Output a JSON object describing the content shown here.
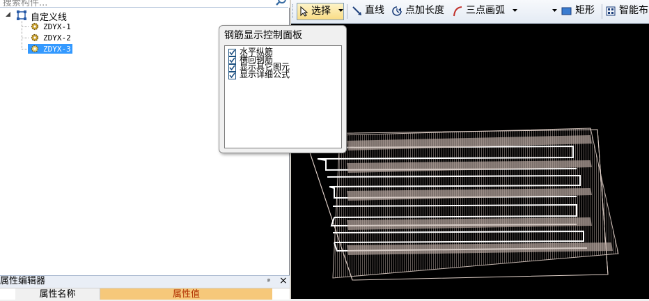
{
  "search": {
    "placeholder": "搜索构件..."
  },
  "tree": {
    "root_label": "自定义线",
    "items": [
      {
        "label": "ZDYX-1",
        "selected": false
      },
      {
        "label": "ZDYX-2",
        "selected": false
      },
      {
        "label": "ZDYX-3",
        "selected": true
      }
    ]
  },
  "property_editor": {
    "title": "属性编辑器",
    "pin_glyph": "ᵖ",
    "close_glyph": "×",
    "column_name": "属性名称",
    "column_value": "属性值"
  },
  "toolbar": {
    "select_label": "选择",
    "line_label": "直线",
    "point_length_label": "点加长度",
    "arc_label": "三点画弧",
    "rect_label": "矩形",
    "smart_label": "智能布"
  },
  "rebar_panel": {
    "title": "钢筋显示控制面板",
    "options": [
      {
        "label": "水平纵筋",
        "checked": true
      },
      {
        "label": "横向钢筋",
        "checked": true
      },
      {
        "label": "显示其它图元",
        "checked": true
      },
      {
        "label": "显示详细公式",
        "checked": true
      }
    ]
  },
  "colors": {
    "selection": "#3399ff",
    "viewport_bg": "#000000",
    "rebar": "#d8c8c0",
    "highlight_header": "#f6c87a"
  }
}
